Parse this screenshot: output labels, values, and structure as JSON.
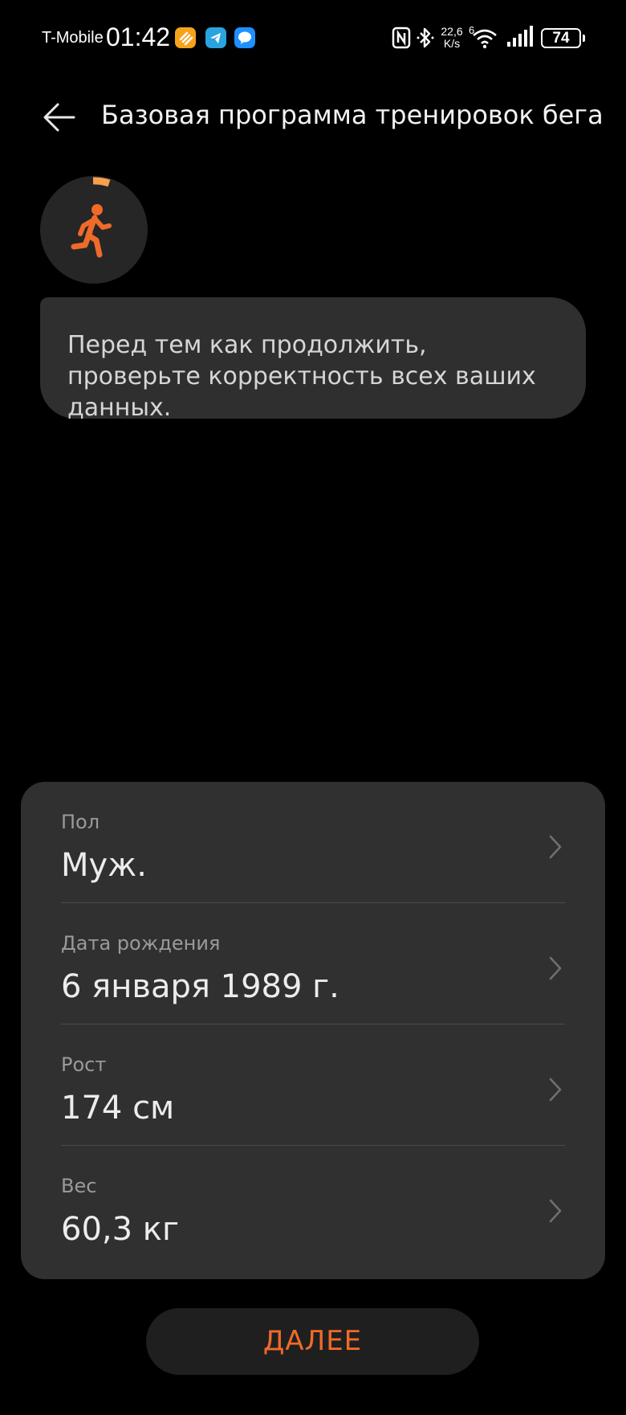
{
  "status_bar": {
    "carrier": "T-Mobile",
    "time": "01:42",
    "net_speed_value": "22,6",
    "net_speed_unit": "K/s",
    "battery_level": "74",
    "signal_badge": "6"
  },
  "header": {
    "title": "Базовая программа тренировок бега",
    "back_icon": "arrow-left-icon"
  },
  "avatar": {
    "icon": "running-person-icon",
    "accent": "#f06a2a",
    "progress_accent": "#f6a04e"
  },
  "message": {
    "text": "Перед тем как продолжить, проверьте корректность всех ваших данных."
  },
  "profile": {
    "rows": [
      {
        "label": "Пол",
        "value": "Муж."
      },
      {
        "label": "Дата рождения",
        "value": "6 января 1989 г."
      },
      {
        "label": "Рост",
        "value": "174 см"
      },
      {
        "label": "Вес",
        "value": "60,3 кг"
      }
    ]
  },
  "actions": {
    "next_label": "ДАЛЕЕ"
  },
  "colors": {
    "background": "#000000",
    "card": "#303030",
    "bubble": "#2f2f30",
    "accent": "#f06a2a"
  }
}
